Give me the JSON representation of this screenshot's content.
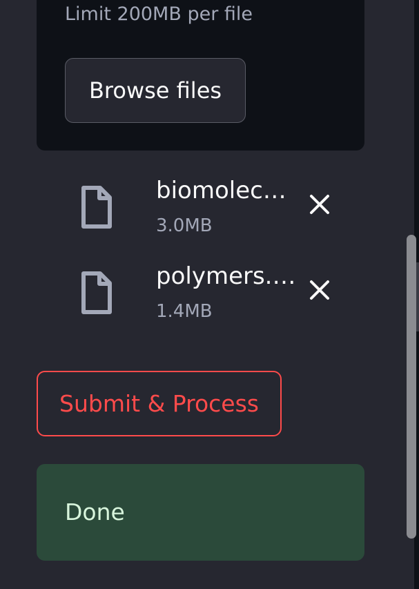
{
  "uploader": {
    "limit_text": "Limit 200MB per file",
    "browse_label": "Browse files"
  },
  "files": [
    {
      "name": "biomolec…",
      "size": "3.0MB",
      "icon": "file-icon",
      "remove_icon": "close-icon"
    },
    {
      "name": "polymers.…",
      "size": "1.4MB",
      "icon": "file-icon",
      "remove_icon": "close-icon"
    }
  ],
  "actions": {
    "submit_label": "Submit & Process"
  },
  "status": {
    "done_text": "Done"
  },
  "colors": {
    "background": "#262730",
    "dropzone": "#0e1117",
    "accent_red": "#ff4b4b",
    "success_bg": "#2b4a3a",
    "success_text": "#d8f5dc",
    "icon_gray": "#a3a8b8"
  }
}
